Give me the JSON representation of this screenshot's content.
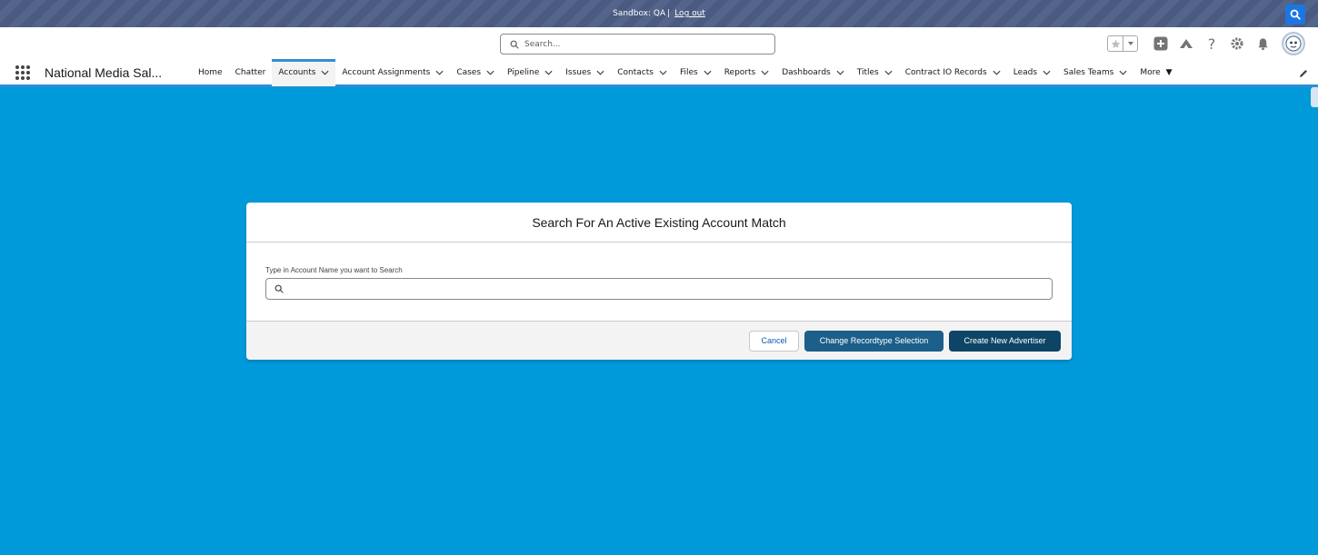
{
  "banner": {
    "sandbox_label": "Sandbox: QA",
    "separator": "|",
    "logout_label": "Log out"
  },
  "header": {
    "search_placeholder": "Search..."
  },
  "nav": {
    "app_name": "National Media Sal...",
    "items": [
      {
        "label": "Home",
        "has_menu": false
      },
      {
        "label": "Chatter",
        "has_menu": false
      },
      {
        "label": "Accounts",
        "has_menu": true,
        "active": true
      },
      {
        "label": "Account Assignments",
        "has_menu": true
      },
      {
        "label": "Cases",
        "has_menu": true
      },
      {
        "label": "Pipeline",
        "has_menu": true
      },
      {
        "label": "Issues",
        "has_menu": true
      },
      {
        "label": "Contacts",
        "has_menu": true
      },
      {
        "label": "Files",
        "has_menu": true
      },
      {
        "label": "Reports",
        "has_menu": true
      },
      {
        "label": "Dashboards",
        "has_menu": true
      },
      {
        "label": "Titles",
        "has_menu": true
      },
      {
        "label": "Contract IO Records",
        "has_menu": true
      },
      {
        "label": "Leads",
        "has_menu": true
      },
      {
        "label": "Sales Teams",
        "has_menu": true
      }
    ],
    "more_label": "More"
  },
  "modal": {
    "title": "Search For An Active Existing Account Match",
    "field_label": "Type in Account Name you want to Search",
    "field_value": "",
    "cancel_label": "Cancel",
    "change_recordtype_label": "Change Recordtype Selection",
    "create_label": "Create New Advertiser"
  },
  "colors": {
    "page_background": "#0099da",
    "banner": "#4a5a80",
    "brand_button": "#1b5f8a",
    "dark_button": "#0d4566",
    "active_tab_border": "#2e8fd6"
  }
}
